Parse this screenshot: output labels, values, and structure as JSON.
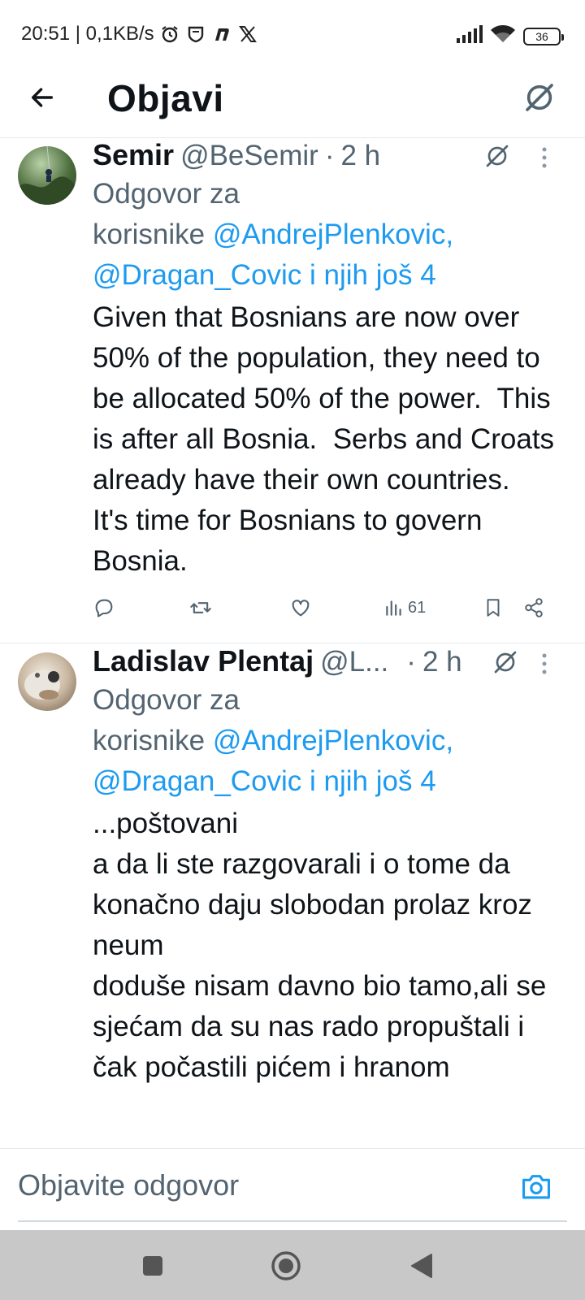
{
  "status_bar": {
    "time_text": "20:51 | 0,1KB/s",
    "battery": "36",
    "icons": [
      "alarm-icon",
      "shield-icon",
      "n-app-icon",
      "x-logo-icon",
      "signal-icon",
      "wifi-icon",
      "battery-icon"
    ]
  },
  "header": {
    "title": "Objavi",
    "back_icon": "arrow-left-icon",
    "grok_icon": "grok-icon"
  },
  "tweets": [
    {
      "name": "Semir",
      "handle": "@BeSemir",
      "separator": "·",
      "time": "2 h",
      "reply_prefix_1": "Odgovor za",
      "reply_prefix_2": "korisnike",
      "mention_1": "@AndrejPlenkovic,",
      "mention_2": "@Dragan_Covic i njih još 4",
      "text": "Given that Bosnians are now over 50% of the population, they need to be allocated 50% of the power.  This is after all Bosnia.  Serbs and Croats already have their own countries.   It's time for Bosnians to govern Bosnia.",
      "views": "61"
    },
    {
      "name": "Ladislav Plentaj",
      "handle": "@L...",
      "separator": "·",
      "time": "2 h",
      "reply_prefix_1": "Odgovor za",
      "reply_prefix_2": "korisnike",
      "mention_1": "@AndrejPlenkovic,",
      "mention_2": "@Dragan_Covic i njih još 4",
      "text": "...poštovani\na da li ste razgovarali i o tome da konačno daju slobodan prolaz kroz neum\ndoduše nisam davno bio tamo,ali se sjećam da su nas rado propuštali i čak počastili pićem i hranom"
    }
  ],
  "reply_bar": {
    "placeholder": "Objavite odgovor",
    "camera_icon": "camera-icon"
  },
  "nav_bar": {
    "icons": [
      "recents-square-icon",
      "home-circle-icon",
      "back-triangle-icon"
    ]
  },
  "colors": {
    "accent": "#1d9bf0",
    "secondary_text": "#536471",
    "primary_text": "#0f1419",
    "nav_bg": "#c8c8c8"
  }
}
